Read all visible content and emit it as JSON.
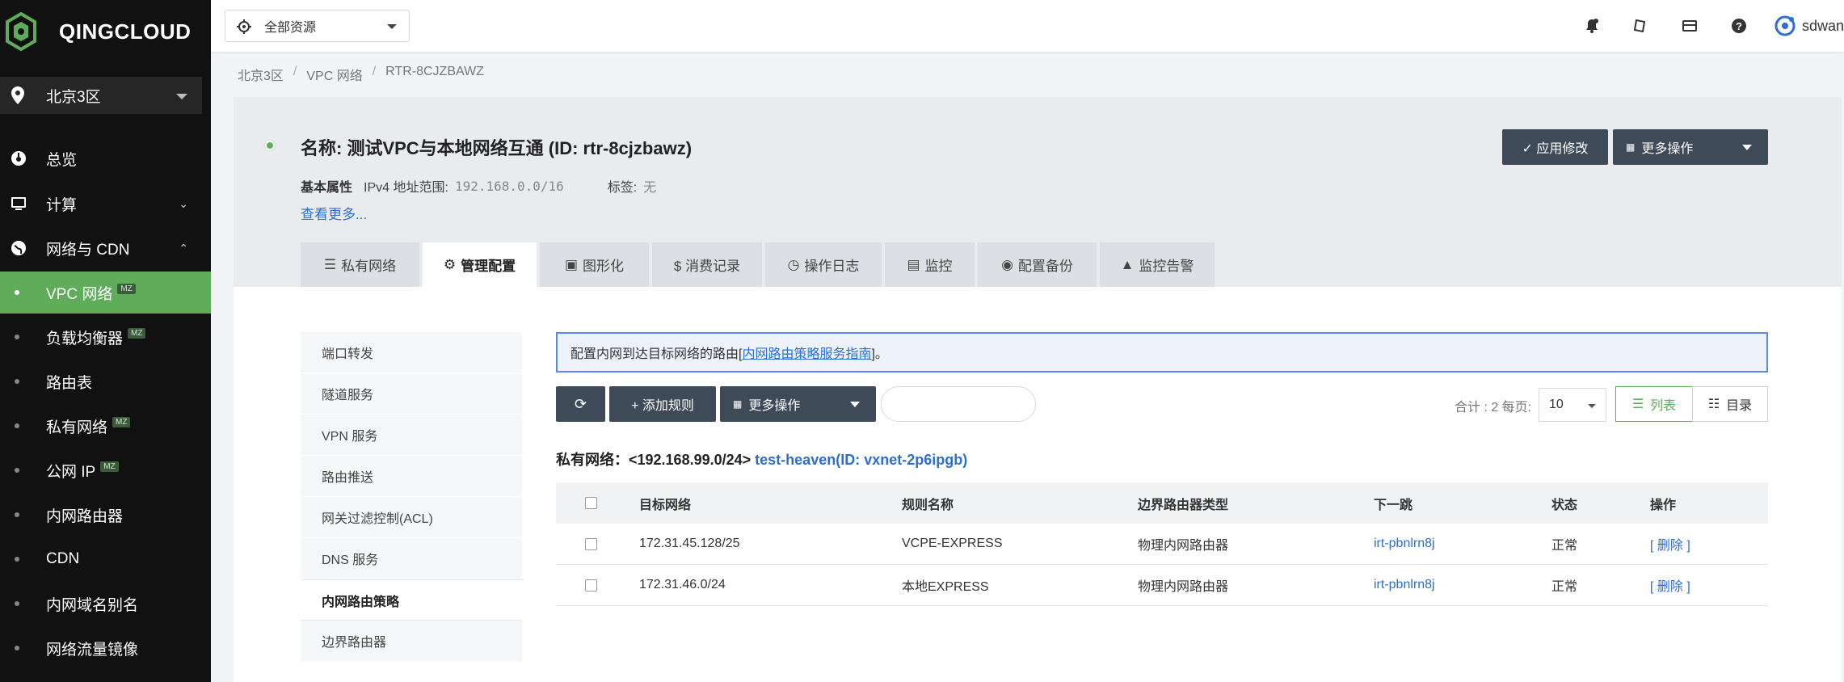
{
  "brand": {
    "name": "QINGCLOUD",
    "accent": "#5fad5b"
  },
  "region": {
    "label": "北京3区"
  },
  "nav": {
    "overview": "总览",
    "compute": "计算",
    "network": "网络与 CDN",
    "sub_items": [
      {
        "label": "VPC 网络",
        "badge": "MZ"
      },
      {
        "label": "负载均衡器",
        "badge": "MZ"
      },
      {
        "label": "路由表",
        "badge": ""
      },
      {
        "label": "私有网络",
        "badge": "MZ"
      },
      {
        "label": "公网 IP",
        "badge": "MZ"
      },
      {
        "label": "内网路由器",
        "badge": ""
      },
      {
        "label": "CDN",
        "badge": ""
      },
      {
        "label": "内网域名别名",
        "badge": ""
      },
      {
        "label": "网络流量镜像",
        "badge": ""
      }
    ]
  },
  "topbar": {
    "resource_scope": "全部资源",
    "user": "sdwan"
  },
  "breadcrumb": [
    "北京3区",
    "VPC 网络",
    "RTR-8CJZBAWZ"
  ],
  "resource": {
    "title": "名称: 测试VPC与本地网络互通 (ID: rtr-8cjzbawz)",
    "props_label": "基本属性",
    "ipv4_key": "IPv4 地址范围:",
    "ipv4_value": "192.168.0.0/16",
    "tag_key": "标签:",
    "tag_value": "无",
    "see_more": "查看更多..."
  },
  "actions": {
    "apply": "✓ 应用修改",
    "more": "更多操作"
  },
  "tabs": [
    "私有网络",
    "管理配置",
    "图形化",
    "$ 消费记录",
    "操作日志",
    "监控",
    "配置备份",
    "监控告警"
  ],
  "side_menu": [
    "端口转发",
    "隧道服务",
    "VPN 服务",
    "路由推送",
    "网关过滤控制(ACL)",
    "DNS 服务",
    "内网路由策略",
    "边界路由器"
  ],
  "notice": {
    "prefix": "配置内网到达目标网络的路由[",
    "link": "内网路由策略服务指南",
    "suffix": "]。"
  },
  "toolbar": {
    "add_rule": "+ 添加规则",
    "more": "更多操作",
    "total": "合计 : 2 每页:",
    "per_page": "10",
    "list": "列表",
    "dir": "目录"
  },
  "vxnet": {
    "prefix": "私有网络：<192.168.99.0/24>",
    "link": "test-heaven(ID: vxnet-2p6ipgb)"
  },
  "table": {
    "headers": [
      "目标网络",
      "规则名称",
      "边界路由器类型",
      "下一跳",
      "状态",
      "操作"
    ],
    "rows": [
      [
        "172.31.45.128/25",
        "VCPE-EXPRESS",
        "物理内网路由器",
        "irt-pbnlrn8j",
        "正常",
        "[ 删除 ]"
      ],
      [
        "172.31.46.0/24",
        "本地EXPRESS",
        "物理内网路由器",
        "irt-pbnlrn8j",
        "正常",
        "[ 删除 ]"
      ]
    ]
  }
}
